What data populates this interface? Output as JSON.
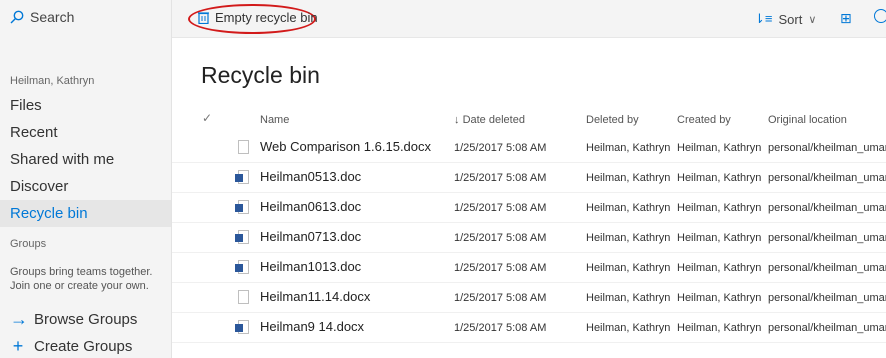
{
  "sidebar": {
    "search_label": "Search",
    "user_name": "Heilman, Kathryn",
    "nav": [
      {
        "label": "Files",
        "active": false
      },
      {
        "label": "Recent",
        "active": false
      },
      {
        "label": "Shared with me",
        "active": false
      },
      {
        "label": "Discover",
        "active": false
      },
      {
        "label": "Recycle bin",
        "active": true
      }
    ],
    "groups_heading": "Groups",
    "groups_description": "Groups bring teams together. Join one or create your own.",
    "browse_groups": "Browse Groups",
    "create_groups": "Create Groups"
  },
  "toolbar": {
    "empty_label": "Empty recycle bin",
    "sort_label": "Sort",
    "accent": "#0078d7",
    "highlight_color": "#d21a1a"
  },
  "main": {
    "title": "Recycle bin",
    "columns": [
      "Name",
      "Date deleted",
      "Deleted by",
      "Created by",
      "Original location"
    ],
    "rows": [
      {
        "name": "Web Comparison 1.6.15.docx",
        "icon": "document-icon",
        "date": "1/25/2017 5:08 AM",
        "deleted_by": "Heilman, Kathryn",
        "created_by": "Heilman, Kathryn",
        "location": "personal/kheilman_umary"
      },
      {
        "name": "Heilman0513.doc",
        "icon": "word-doc-icon",
        "date": "1/25/2017 5:08 AM",
        "deleted_by": "Heilman, Kathryn",
        "created_by": "Heilman, Kathryn",
        "location": "personal/kheilman_umary"
      },
      {
        "name": "Heilman0613.doc",
        "icon": "word-doc-icon",
        "date": "1/25/2017 5:08 AM",
        "deleted_by": "Heilman, Kathryn",
        "created_by": "Heilman, Kathryn",
        "location": "personal/kheilman_umary"
      },
      {
        "name": "Heilman0713.doc",
        "icon": "word-doc-icon",
        "date": "1/25/2017 5:08 AM",
        "deleted_by": "Heilman, Kathryn",
        "created_by": "Heilman, Kathryn",
        "location": "personal/kheilman_umary"
      },
      {
        "name": "Heilman1013.doc",
        "icon": "word-doc-icon",
        "date": "1/25/2017 5:08 AM",
        "deleted_by": "Heilman, Kathryn",
        "created_by": "Heilman, Kathryn",
        "location": "personal/kheilman_umary"
      },
      {
        "name": "Heilman11.14.docx",
        "icon": "document-icon",
        "date": "1/25/2017 5:08 AM",
        "deleted_by": "Heilman, Kathryn",
        "created_by": "Heilman, Kathryn",
        "location": "personal/kheilman_umary"
      },
      {
        "name": "Heilman9 14.docx",
        "icon": "word-doc-icon",
        "date": "1/25/2017 5:08 AM",
        "deleted_by": "Heilman, Kathryn",
        "created_by": "Heilman, Kathryn",
        "location": "personal/kheilman_umary"
      }
    ]
  }
}
